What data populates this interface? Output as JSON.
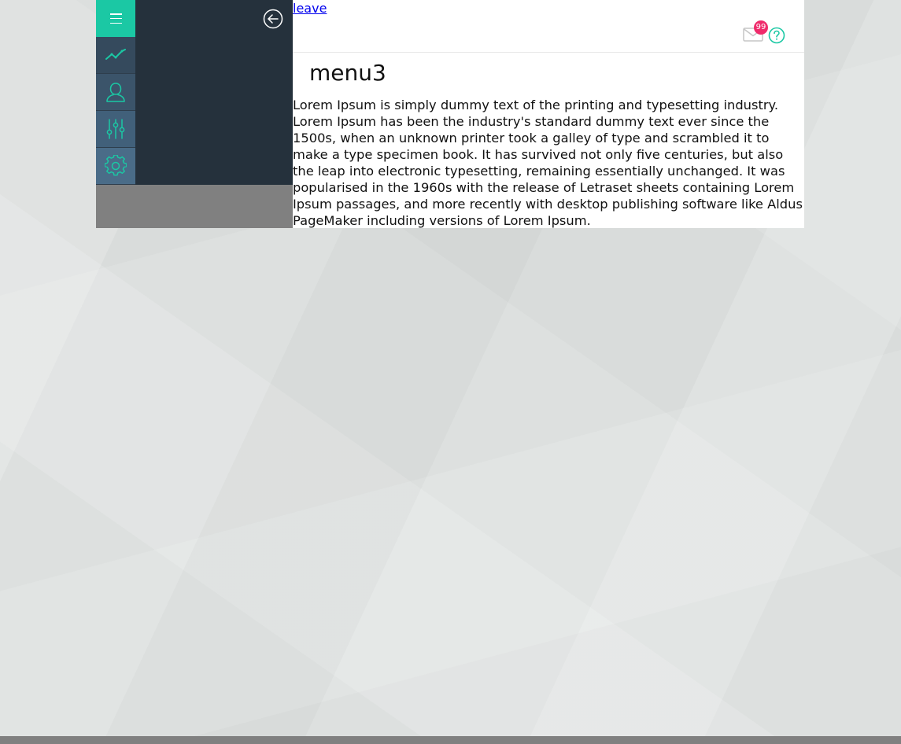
{
  "sidebar": {
    "items": [
      {
        "id": "menu",
        "icon": "hamburger-menu-icon"
      },
      {
        "id": "analytics",
        "icon": "trend-line-icon"
      },
      {
        "id": "users",
        "icon": "user-icon"
      },
      {
        "id": "filters",
        "icon": "sliders-icon"
      },
      {
        "id": "settings",
        "icon": "gear-icon"
      }
    ],
    "back_icon": "arrow-left-circle-icon"
  },
  "header": {
    "leave_link": "leave",
    "mail_icon": "envelope-icon",
    "mail_badge_count": "99",
    "help_icon": "question-circle-icon"
  },
  "main": {
    "title": "menu3",
    "paragraph": "Lorem Ipsum is simply dummy text of the printing and typesetting industry. Lorem Ipsum has been the industry's standard dummy text ever since the 1500s, when an unknown printer took a galley of type and scrambled it to make a type specimen book. It has survived not only five centuries, but also the leap into electronic typesetting, remaining essentially unchanged. It was popularised in the 1960s with the release of Letraset sheets containing Lorem Ipsum passages, and more recently with desktop publishing software like Aldus PageMaker including versions of Lorem Ipsum."
  },
  "colors": {
    "accent": "#1bc8a4",
    "rail": "#2e3e4d",
    "drawer": "#25313c",
    "badge": "#ef2b6b"
  }
}
